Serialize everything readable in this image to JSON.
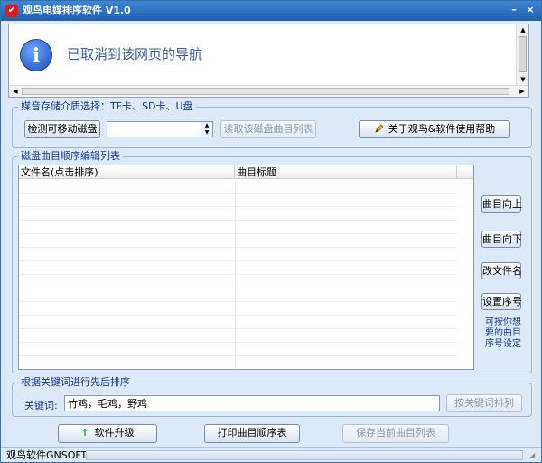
{
  "window": {
    "title": "观鸟电媒排序软件 V1.0",
    "app_icon": "check-logo-icon",
    "minimize_glyph": "–",
    "close_glyph": "×"
  },
  "browser": {
    "message": "已取消到该网页的导航",
    "info_icon_glyph": "i"
  },
  "media_group": {
    "label": "媒音存储介质选择：TF卡、SD卡、U盘",
    "detect_button": "检测可移动磁盘",
    "drive_value": "",
    "read_button": "读取该磁盘曲目列表",
    "help_button": "关于观鸟&软件使用帮助"
  },
  "list_group": {
    "label": "磁盘曲目顺序编辑列表",
    "columns": [
      "文件名(点击排序)",
      "曲目标题"
    ],
    "row_count": 14
  },
  "side_buttons": {
    "up": "曲目向上",
    "down": "曲目向下",
    "rename": "改文件名",
    "set_seq": "设置序号",
    "hint": "可按你想要的曲目序号设定"
  },
  "keyword_group": {
    "label": "根据关键词进行先后排序",
    "field_label": "关键词:",
    "field_value": "竹鸡，毛鸡，野鸡",
    "sort_button": "按关键词排列"
  },
  "bottom_buttons": {
    "upgrade": "软件升级",
    "print": "打印曲目顺序表",
    "save": "保存当前曲目列表"
  },
  "status": {
    "text": "观鸟软件GNSOFT"
  }
}
